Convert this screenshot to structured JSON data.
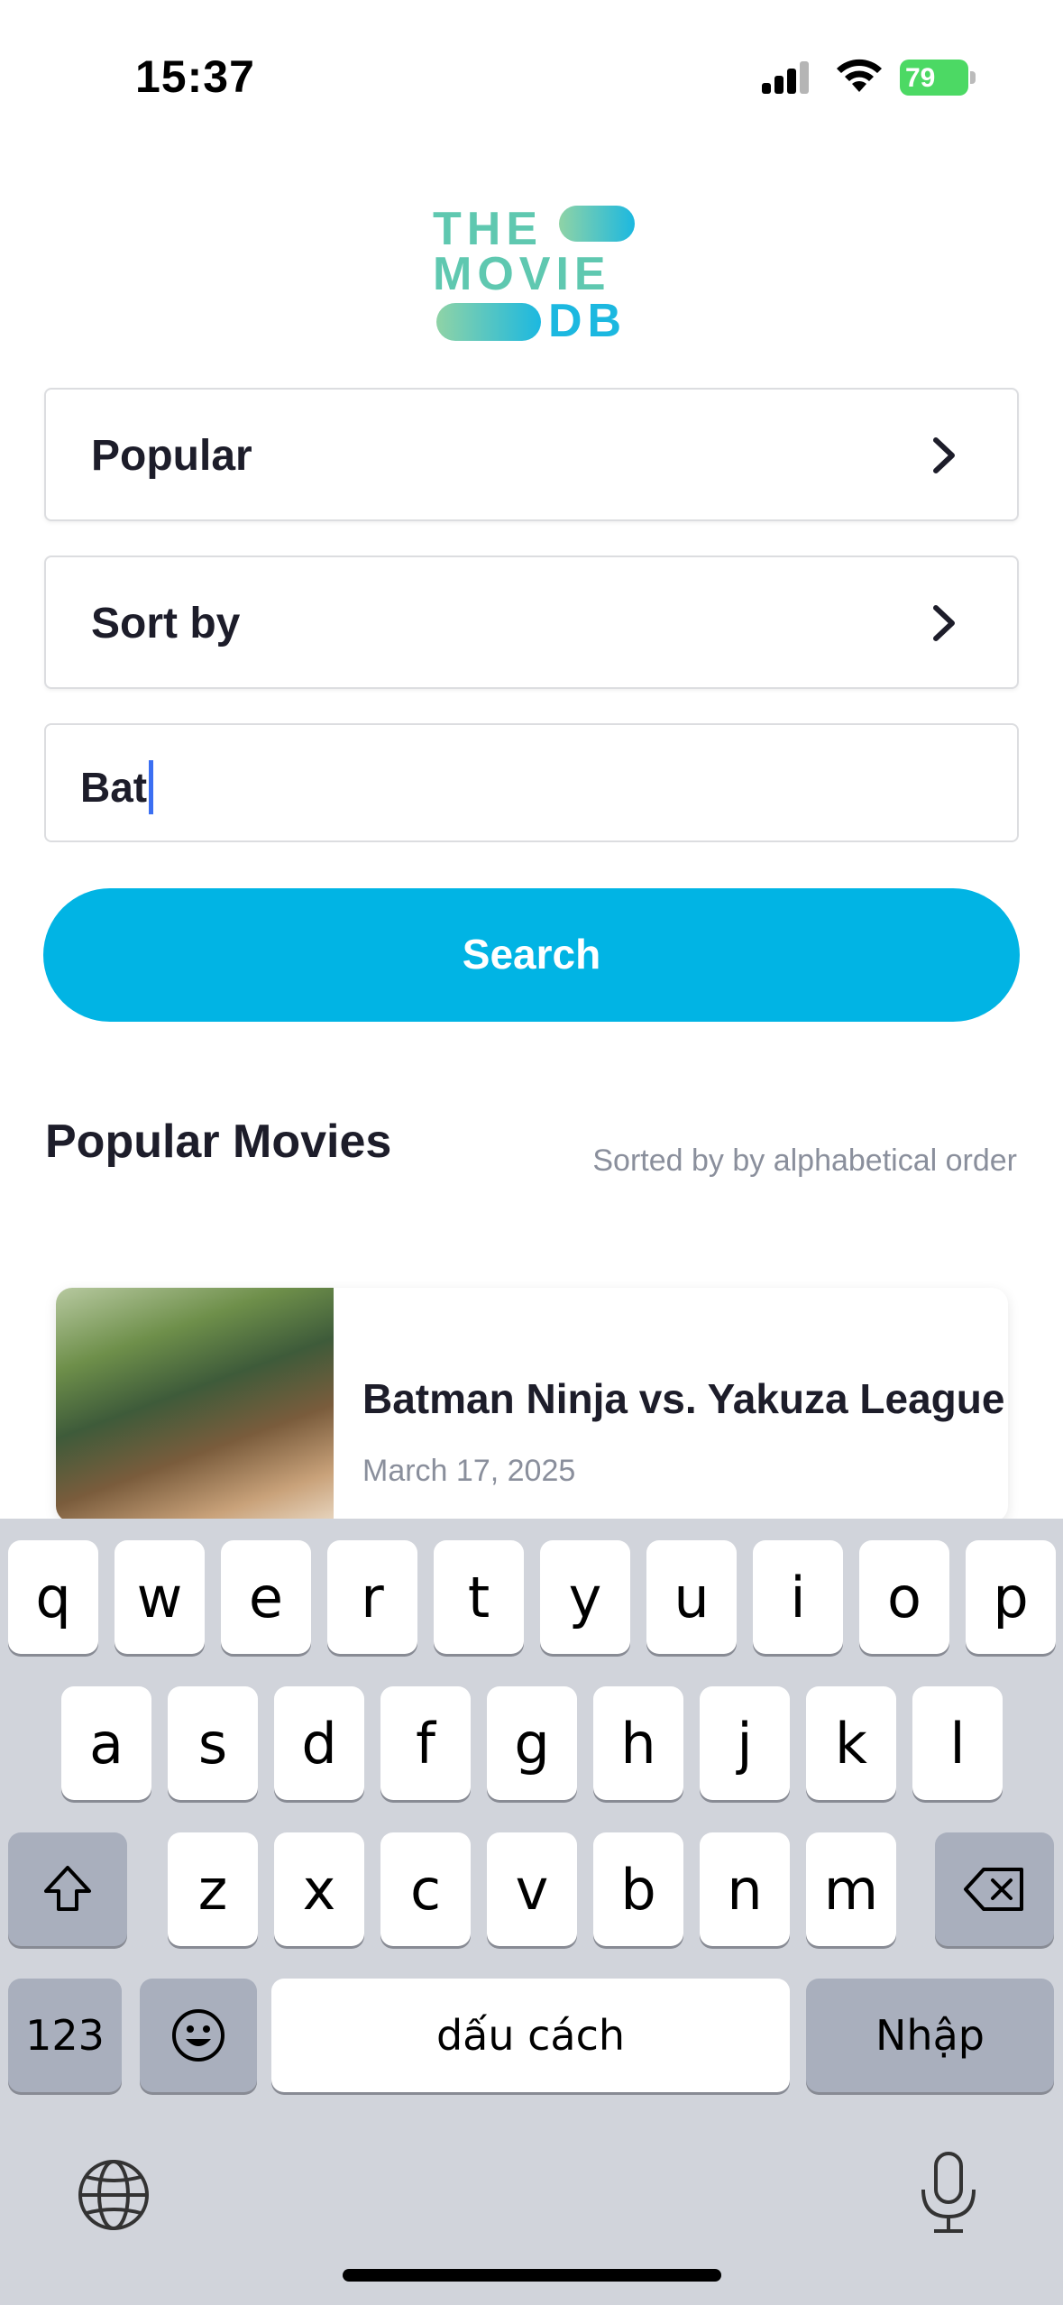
{
  "status_bar": {
    "time": "15:37",
    "battery": "79"
  },
  "logo": {
    "line1": "THE",
    "line2": "MOVIE",
    "line3": "DB"
  },
  "filters": {
    "category": "Popular",
    "sort": "Sort by"
  },
  "search": {
    "value": "Bat",
    "button_label": "Search"
  },
  "section": {
    "title": "Popular Movies",
    "subtitle": "Sorted by by alphabetical order"
  },
  "movies": [
    {
      "title": "Batman Ninja vs. Yakuza League",
      "date": "March 17, 2025"
    }
  ],
  "keyboard": {
    "row1": [
      "q",
      "w",
      "e",
      "r",
      "t",
      "y",
      "u",
      "i",
      "o",
      "p"
    ],
    "row2": [
      "a",
      "s",
      "d",
      "f",
      "g",
      "h",
      "j",
      "k",
      "l"
    ],
    "row3": [
      "z",
      "x",
      "c",
      "v",
      "b",
      "n",
      "m"
    ],
    "numbers_label": "123",
    "space_label": "dấu cách",
    "return_label": "Nhập"
  },
  "colors": {
    "accent": "#01b4e4",
    "keyboard_bg": "#d1d4db"
  }
}
